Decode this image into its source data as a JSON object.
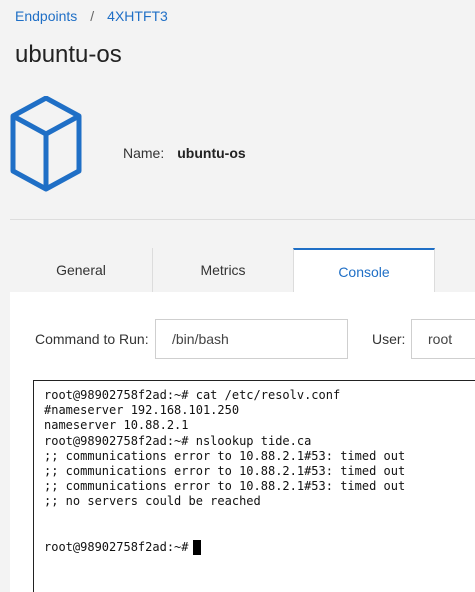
{
  "breadcrumb": {
    "items": [
      "Endpoints",
      "4XHTFT3"
    ],
    "separator": "/"
  },
  "page": {
    "title": "ubuntu-os"
  },
  "details": {
    "name_label": "Name:",
    "name_value": "ubuntu-os",
    "icon": "cube-icon"
  },
  "tabs": [
    {
      "label": "General",
      "active": false
    },
    {
      "label": "Metrics",
      "active": false
    },
    {
      "label": "Console",
      "active": true
    }
  ],
  "console": {
    "command_label": "Command to Run:",
    "command_value": "/bin/bash",
    "user_label": "User:",
    "user_value": "root",
    "terminal_lines": [
      "root@98902758f2ad:~# cat /etc/resolv.conf",
      "#nameserver 192.168.101.250",
      "nameserver 10.88.2.1",
      "root@98902758f2ad:~# nslookup tide.ca",
      ";; communications error to 10.88.2.1#53: timed out",
      ";; communications error to 10.88.2.1#53: timed out",
      ";; communications error to 10.88.2.1#53: timed out",
      ";; no servers could be reached",
      "",
      ""
    ],
    "prompt": "root@98902758f2ad:~#"
  },
  "colors": {
    "accent": "#1f6fc6",
    "background": "#f3f3f3",
    "panel": "#ffffff"
  }
}
